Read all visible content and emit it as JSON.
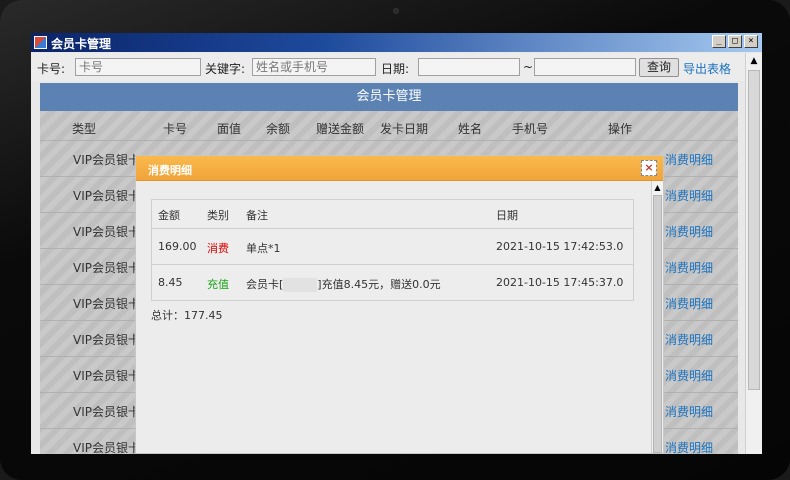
{
  "window": {
    "title": "会员卡管理"
  },
  "toolbar": {
    "card_label": "卡号:",
    "card_placeholder": "卡号",
    "keyword_label": "关键字:",
    "keyword_placeholder": "姓名或手机号",
    "date_label": "日期:",
    "date_sep": "~",
    "query_button": "查询",
    "export_link": "导出表格"
  },
  "grid": {
    "title": "会员卡管理",
    "columns": [
      "类型",
      "卡号",
      "面值",
      "余额",
      "赠送金额",
      "发卡日期",
      "姓名",
      "手机号",
      "操作"
    ],
    "rows": [
      {
        "type": "VIP会员银卡",
        "action": "消费明细"
      },
      {
        "type": "VIP会员银卡",
        "action": "消费明细"
      },
      {
        "type": "VIP会员银卡",
        "action": "消费明细"
      },
      {
        "type": "VIP会员银卡",
        "action": "消费明细"
      },
      {
        "type": "VIP会员银卡",
        "action": "消费明细"
      },
      {
        "type": "VIP会员银卡",
        "action": "消费明细"
      },
      {
        "type": "VIP会员银卡",
        "action": "消费明细"
      },
      {
        "type": "VIP会员银卡",
        "action": "消费明细"
      },
      {
        "type": "VIP会员银卡",
        "action": "消费明细"
      }
    ]
  },
  "modal": {
    "title": "消费明细",
    "close": "×",
    "headers": {
      "amount": "金额",
      "type": "类别",
      "note": "备注",
      "date": "日期"
    },
    "rows": [
      {
        "amount": "169.00",
        "type": "消费",
        "note": "单点*1",
        "date": "2021-10-15 17:42:53.0"
      },
      {
        "amount": "8.45",
        "type": "充值",
        "note_prefix": "会员卡[",
        "note_suffix": "]充值8.45元，赠送0.0元",
        "date": "2021-10-15 17:45:37.0"
      }
    ],
    "total_label": "总计：",
    "total_value": "177.45"
  },
  "colors": {
    "titlebar": "#0a246a",
    "grid_header": "#5b82b3",
    "modal_header": "#f5ab40",
    "link": "#1a72c0",
    "consume": "#e00000",
    "recharge": "#1aa51a"
  }
}
